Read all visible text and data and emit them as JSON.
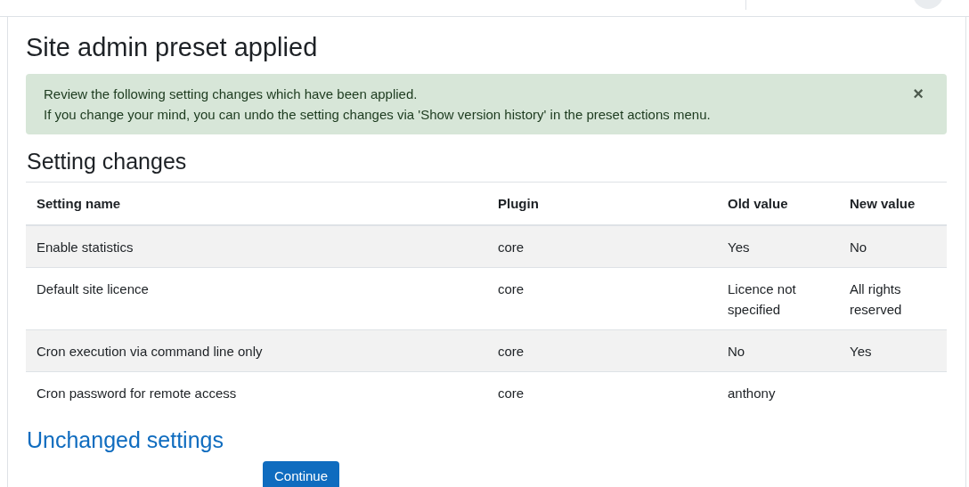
{
  "page_title": "Site admin preset applied",
  "alert": {
    "lines": [
      "Review the following setting changes which have been applied.",
      "If you change your mind, you can undo the setting changes via 'Show version history' in the preset actions menu."
    ],
    "close": "×"
  },
  "changes_heading": "Setting changes",
  "table": {
    "columns": [
      "Setting name",
      "Plugin",
      "Old value",
      "New value"
    ],
    "rows": [
      [
        "Enable statistics",
        "core",
        "Yes",
        "No"
      ],
      [
        "Default site licence",
        "core",
        "Licence not specified",
        "All rights reserved"
      ],
      [
        "Cron execution via command line only",
        "core",
        "No",
        "Yes"
      ],
      [
        "Cron password for remote access",
        "core",
        "anthony",
        ""
      ]
    ]
  },
  "unchanged_heading": "Unchanged settings",
  "continue_button": "Continue"
}
